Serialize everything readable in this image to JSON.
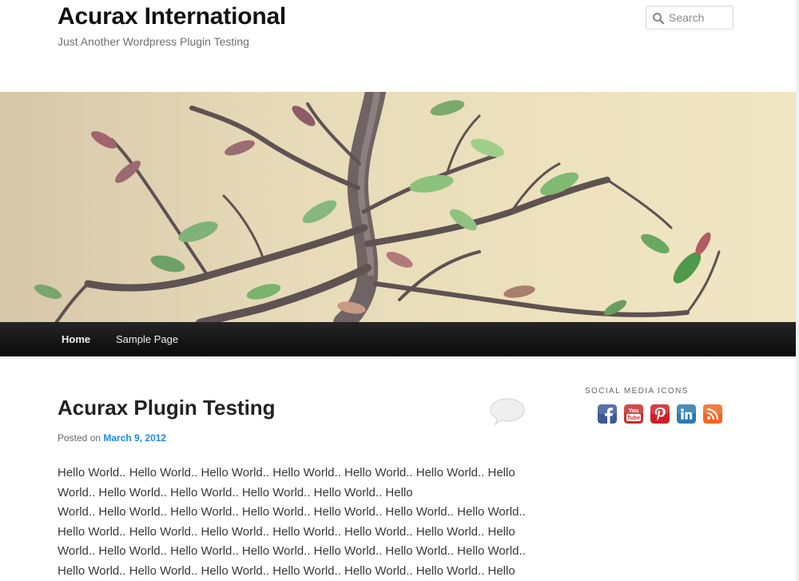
{
  "header": {
    "site_title": "Acurax International",
    "site_description": "Just Another Wordpress Plugin Testing",
    "search_placeholder": "Search"
  },
  "nav": {
    "items": [
      {
        "label": "Home"
      },
      {
        "label": "Sample Page"
      }
    ]
  },
  "post": {
    "title": "Acurax Plugin Testing",
    "posted_on_label": "Posted on",
    "date": "March 9, 2012",
    "lines": [
      "Hello World.. Hello World.. Hello World.. Hello World.. Hello World.. Hello World.. Hello",
      "World.. Hello World.. Hello World.. Hello World.. Hello World.. Hello",
      "World.. Hello World.. Hello World.. Hello World.. Hello World.. Hello World.. Hello World..",
      "Hello World.. Hello World.. Hello World.. Hello World.. Hello World.. Hello World.. Hello",
      "World.. Hello World.. Hello World.. Hello World.. Hello World.. Hello World.. Hello World..",
      "Hello World.. Hello World.. Hello World.. Hello World.. Hello World.. Hello World.. Hello"
    ]
  },
  "sidebar": {
    "widget_title": "SOCIAL MEDIA ICONS",
    "icons": [
      {
        "name": "facebook-icon",
        "glyph": "f",
        "color": "#3b5998"
      },
      {
        "name": "youtube-icon",
        "glyph": "You Tube",
        "color": "#c4302b"
      },
      {
        "name": "pinterest-icon",
        "glyph": "P",
        "color": "#cb2027"
      },
      {
        "name": "linkedin-icon",
        "glyph": "in",
        "color": "#2a7ab0"
      },
      {
        "name": "rss-icon",
        "glyph": "rss",
        "color": "#f26522"
      }
    ]
  },
  "colors": {
    "link": "#1b8be0",
    "nav_bg": "#111111"
  }
}
